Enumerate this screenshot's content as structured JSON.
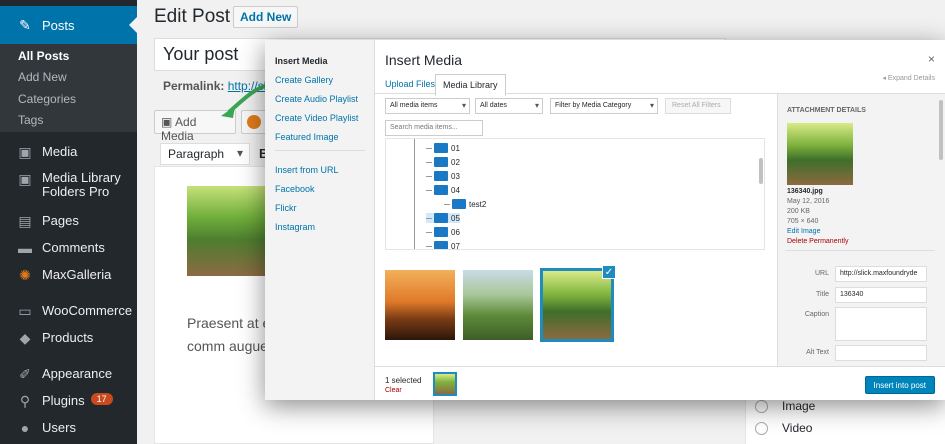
{
  "sidebar": {
    "posts": "Posts",
    "submenu": [
      "All Posts",
      "Add New",
      "Categories",
      "Tags"
    ],
    "media": "Media",
    "mlf_line1": "Media Library",
    "mlf_line2": "Folders Pro",
    "pages": "Pages",
    "comments": "Comments",
    "maxgalleria": "MaxGalleria",
    "woocommerce": "WooCommerce",
    "products": "Products",
    "appearance": "Appearance",
    "plugins": "Plugins",
    "plugins_badge": "17",
    "users": "Users"
  },
  "editor": {
    "page_title": "Edit Post",
    "add_new": "Add New",
    "post_title": "Your post",
    "permalink_label": "Permalink:",
    "permalink_url": "http://slic",
    "add_media": "Add Media",
    "format": "Paragraph",
    "bold": "B",
    "body_text": "Praesent at e massa eu ele purus, comm augue. Sed c"
  },
  "format_box": {
    "image": "Image",
    "video": "Video"
  },
  "modal": {
    "menu": {
      "insert_media": "Insert Media",
      "create_gallery": "Create Gallery",
      "create_audio_playlist": "Create Audio Playlist",
      "create_video_playlist": "Create Video Playlist",
      "featured_image": "Featured Image",
      "insert_from_url": "Insert from URL",
      "facebook": "Facebook",
      "flickr": "Flickr",
      "instagram": "Instagram"
    },
    "title": "Insert Media",
    "close": "×",
    "tabs": {
      "upload": "Upload Files",
      "library": "Media Library"
    },
    "expand_details": "Expand Details",
    "filters": {
      "media_items": "All media items",
      "dates": "All dates",
      "category": "Filter by Media Category",
      "reset": "Reset All Filters",
      "search_placeholder": "Search media items..."
    },
    "folders": [
      "01",
      "02",
      "03",
      "04",
      "test2",
      "05",
      "06",
      "07"
    ],
    "attachment": {
      "heading": "ATTACHMENT DETAILS",
      "filename": "136340.jpg",
      "date": "May 12, 2016",
      "size": "200 KB",
      "dimensions": "705 × 640",
      "edit_image": "Edit Image",
      "delete": "Delete Permanently",
      "url_label": "URL",
      "url_value": "http://slick.maxfoundryde",
      "title_label": "Title",
      "title_value": "136340",
      "caption_label": "Caption",
      "alt_label": "Alt Text"
    },
    "toolbar": {
      "selected": "1 selected",
      "clear": "Clear",
      "insert": "Insert into post"
    }
  },
  "colors": {
    "sidebar_bg": "#23282d",
    "current_menu": "#0073aa",
    "primary_button": "#0085ba",
    "folder": "#1b78c4",
    "badge": "#ca4a1f"
  }
}
